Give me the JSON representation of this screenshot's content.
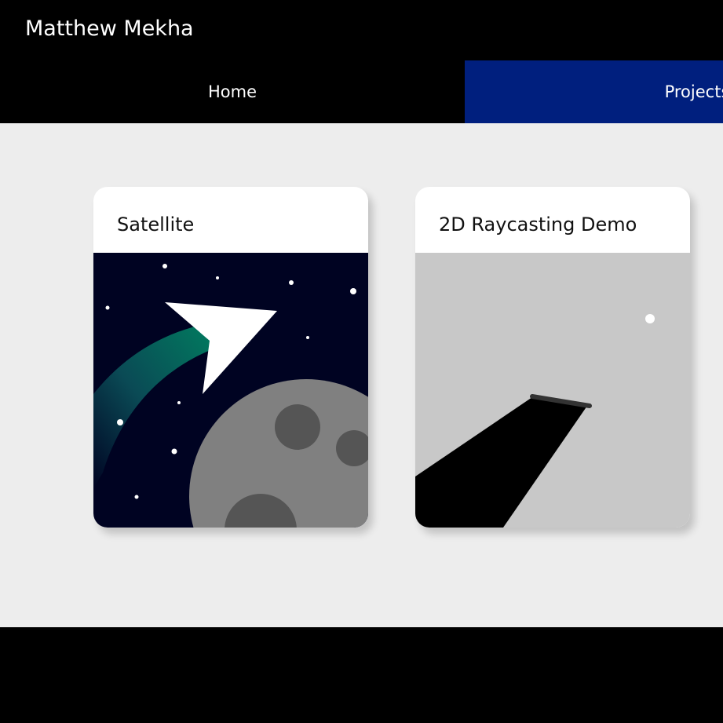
{
  "header": {
    "title": "Matthew Mekha"
  },
  "nav": {
    "tabs": [
      {
        "label": "Home"
      },
      {
        "label": "Projects"
      }
    ]
  },
  "projects": [
    {
      "title": "Satellite",
      "image_icon": "satellite-illustration"
    },
    {
      "title": "2D Raycasting Demo",
      "image_icon": "raycasting-illustration"
    }
  ],
  "colors": {
    "header_bg": "#000000",
    "active_tab_bg": "#001f7e",
    "content_bg": "#ededed",
    "card_bg": "#ffffff",
    "satellite_sky": "#000322",
    "moon": "#808080",
    "raycast_bg": "#c8c8c8"
  }
}
